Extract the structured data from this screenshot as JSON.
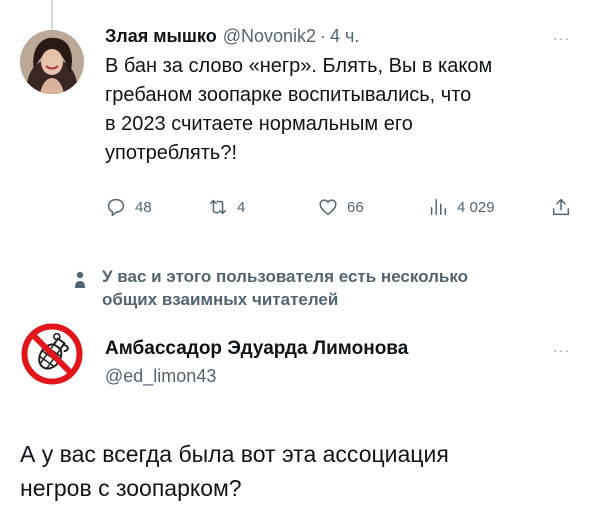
{
  "tweet1": {
    "author_name": "Злая мышко",
    "handle": "@Novonik2",
    "separator": "·",
    "time": "4 ч.",
    "more": "···",
    "text_lines": [
      "В бан за слово «негр». Блять, Вы в каком",
      "гребаном зоопарке воспитывались, что",
      "в 2023 считаете нормальным его",
      "употреблять?!"
    ],
    "actions": {
      "replies": "48",
      "retweets": "4",
      "likes": "66",
      "views": "4 029"
    }
  },
  "mutual_followers": {
    "lines": [
      "У вас и этого пользователя есть несколько",
      "общих взаимных читателей"
    ]
  },
  "tweet2": {
    "author_name": "Амбассадор Эдуарда Лимонова",
    "handle": "@ed_limon43",
    "more": "···",
    "text_lines": [
      "А у вас всегда была вот эта ассоциация",
      "негров с зоопарком?"
    ]
  },
  "colors": {
    "text": "#0f1419",
    "secondary": "#536471",
    "avatar_ring": "#e0161b"
  }
}
